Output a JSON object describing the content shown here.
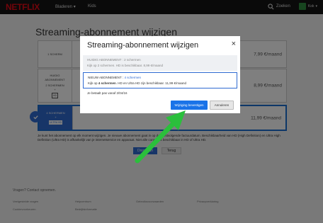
{
  "header": {
    "logo": "NETFLIX",
    "nav": {
      "browse": "Bladeren",
      "browse_caret": "▾",
      "kids": "Kids"
    },
    "search_label": "Zoeken",
    "profile_name": "Kok",
    "profile_caret": "▾"
  },
  "page": {
    "title": "Streaming-abonnement wijzigen",
    "plans": [
      {
        "name": "1 SCHERM",
        "price": "7,99 €/maand"
      },
      {
        "name_line1": "HUIDIG",
        "name_line2": "ABONNEMENT",
        "name_line3": "2 SCHERMEN",
        "name_line4": "+",
        "badge": "HD",
        "price": "8,99 €/maand"
      },
      {
        "name_line1": "4 SCHERMEN",
        "name_line2": "+",
        "badge": "ULTRA HD",
        "price": "11,99 €/maand"
      }
    ],
    "info_text": "Je kunt het abonnement op elk moment wijzigen. Je nieuwe abonnement gaat in op de eerstvolgende factuurdatum. Beschikbaarheid van HD (High Definition) en Ultra High Definition (Ultra HD) is afhankelijk van je internetservice en apparaat. Niet alle content is beschikbaar in HD of Ultra HD.",
    "continue_label": "Doorgaan",
    "back_label": "Terug"
  },
  "footer": {
    "question": "Vragen? Contact opnemen.",
    "links": [
      "Veelgestelde vragen",
      "Helpcentrum",
      "Gebruiksvoorwaarden",
      "Privacyverklaring",
      "Cookievoorkeuren",
      "Bedrijfsinformatie"
    ]
  },
  "modal": {
    "title": "Streaming-abonnement wijzigen",
    "close": "×",
    "old_plan_label": "HUIDIG ABONNEMENT : 2 schermen",
    "old_plan_desc": "Kijk op 2 schermen. HD is beschikbaar. 8,99 €/maand",
    "new_plan_prefix": "NIEUW ABONNEMENT : ",
    "new_plan_value": "4 schermen",
    "new_plan_desc_prefix": "Kijk op ",
    "new_plan_desc_bold": "4 schermen",
    "new_plan_desc_suffix": ". HD en Ultra HD zijn beschikbaar. 11,99 €/maand",
    "pay_note": "Je betaalt pas vanaf 2/04/16",
    "confirm_label": "Wijziging bevestigen",
    "cancel_label": "Annuleren"
  },
  "colors": {
    "brand": "#e50914",
    "accent": "#2f6ad1",
    "arrow": "#2bbf3c"
  }
}
